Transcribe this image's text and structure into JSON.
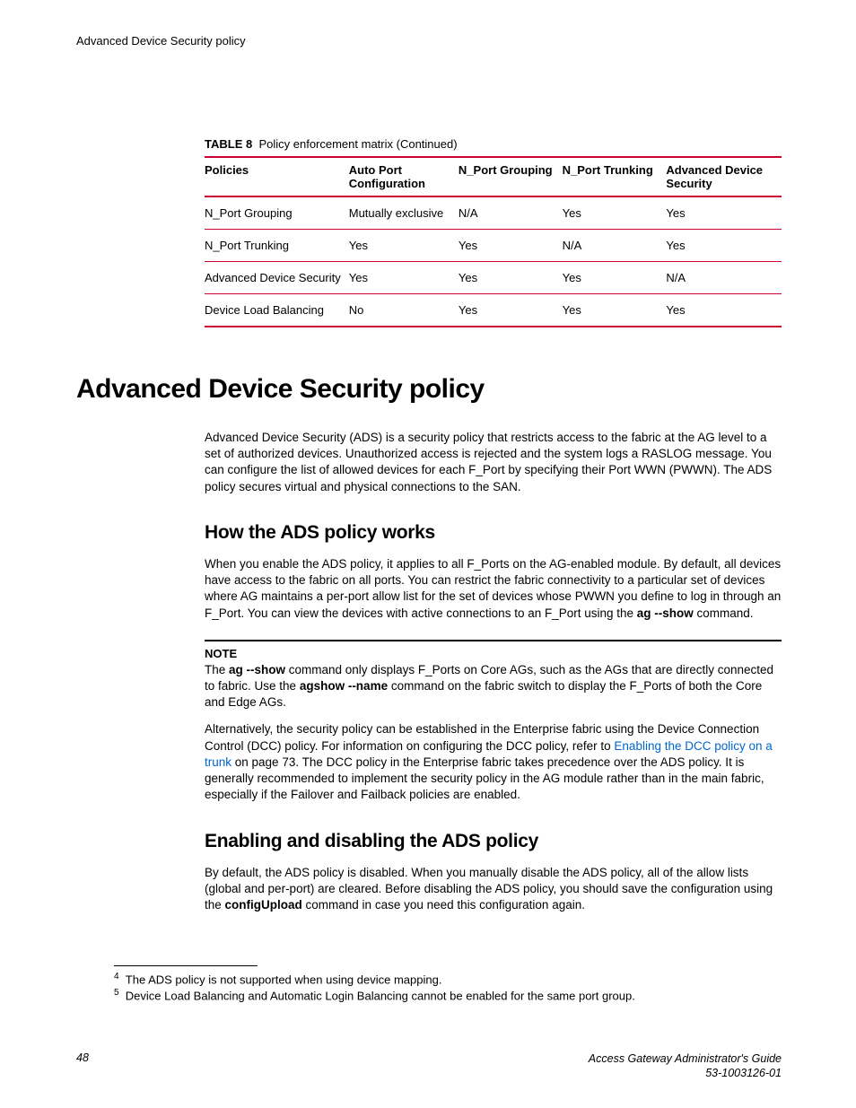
{
  "header": {
    "running": "Advanced Device Security policy"
  },
  "table": {
    "caption_label": "TABLE 8",
    "caption_text": "Policy enforcement matrix (Continued)",
    "headers": [
      "Policies",
      "Auto Port Configuration",
      "N_Port Grouping",
      "N_Port Trunking",
      "Advanced Device Security"
    ],
    "rows": [
      [
        "N_Port Grouping",
        "Mutually exclusive",
        "N/A",
        "Yes",
        "Yes"
      ],
      [
        "N_Port Trunking",
        "Yes",
        "Yes",
        "N/A",
        "Yes"
      ],
      [
        "Advanced Device Security",
        "Yes",
        "Yes",
        "Yes",
        "N/A"
      ],
      [
        "Device Load Balancing",
        "No",
        "Yes",
        "Yes",
        "Yes"
      ]
    ]
  },
  "h1": "Advanced Device Security policy",
  "p1": "Advanced Device Security (ADS) is a security policy that restricts access to the fabric at the AG level to a set of authorized devices. Unauthorized access is rejected and the system logs a RASLOG message. You can configure the list of allowed devices for each F_Port by specifying their Port WWN (PWWN). The ADS policy secures virtual and physical connections to the SAN.",
  "h2a": "How the ADS policy works",
  "p2_pre": "When you enable the ADS policy, it applies to all F_Ports on the AG-enabled module. By default, all devices have access to the fabric on all ports. You can restrict the fabric connectivity to a particular set of devices where AG maintains a per-port allow list for the set of devices whose PWWN you define to log in through an F_Port. You can view the devices with active connections to an F_Port using the ",
  "p2_cmd": "ag --show",
  "p2_post": " command.",
  "note": {
    "label": "NOTE",
    "t1": "The ",
    "cmd1": "ag --show",
    "t2": " command only displays F_Ports on Core AGs, such as the AGs that are directly connected to fabric. Use the ",
    "cmd2": "agshow --name",
    "t3": " command on the fabric switch to display the F_Ports of both the Core and Edge AGs."
  },
  "p3": {
    "t1": "Alternatively, the security policy can be established in the Enterprise fabric using the Device Connection Control (DCC) policy. For information on configuring the DCC policy, refer to ",
    "link": "Enabling the DCC policy on a trunk",
    "t2": " on page 73. The DCC policy in the Enterprise fabric takes precedence over the ADS policy. It is generally recommended to implement the security policy in the AG module rather than in the main fabric, especially if the Failover and Failback policies are enabled."
  },
  "h2b": "Enabling and disabling the ADS policy",
  "p4_pre": "By default, the ADS policy is disabled. When you manually disable the ADS policy, all of the allow lists (global and per-port) are cleared. Before disabling the ADS policy, you should save the configuration using the ",
  "p4_cmd": "configUpload",
  "p4_post": " command in case you need this configuration again.",
  "footnotes": {
    "n4": "4",
    "t4": "The ADS policy is not supported when using device mapping.",
    "n5": "5",
    "t5": "Device Load Balancing and Automatic Login Balancing cannot be enabled for the same port group."
  },
  "footer": {
    "page": "48",
    "doc1": "Access Gateway Administrator's Guide",
    "doc2": "53-1003126-01"
  }
}
